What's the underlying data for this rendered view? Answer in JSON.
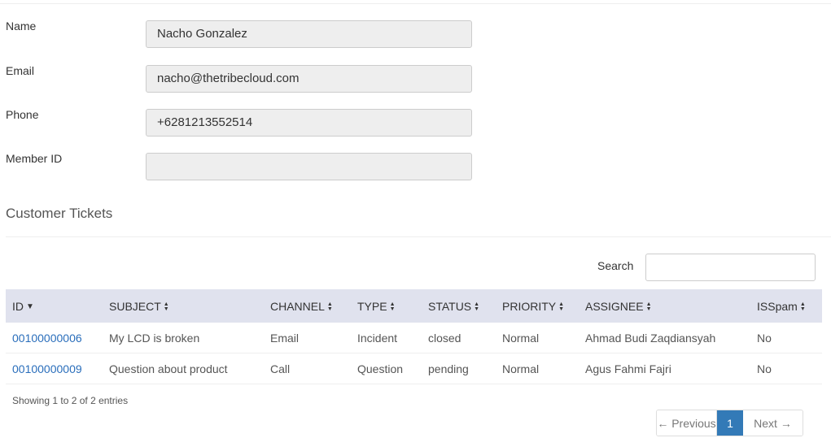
{
  "form": {
    "fields": [
      {
        "label": "Name",
        "value": "Nacho Gonzalez"
      },
      {
        "label": "Email",
        "value": "nacho@thetribecloud.com"
      },
      {
        "label": "Phone",
        "value": "+6281213552514"
      },
      {
        "label": "Member ID",
        "value": ""
      }
    ]
  },
  "tickets_section": {
    "title": "Customer Tickets",
    "search_label": "Search",
    "search_value": ""
  },
  "table": {
    "columns": [
      "ID",
      "SUBJECT",
      "CHANNEL",
      "TYPE",
      "STATUS",
      "PRIORITY",
      "ASSIGNEE",
      "ISSpam"
    ],
    "sorted_column": "ID",
    "sort_direction": "descending",
    "rows": [
      {
        "id": "00100000006",
        "subject": "My LCD is broken",
        "channel": "Email",
        "type": "Incident",
        "status": "closed",
        "priority": "Normal",
        "assignee": "Ahmad Budi Zaqdiansyah",
        "isspam": "No"
      },
      {
        "id": "00100000009",
        "subject": "Question about product",
        "channel": "Call",
        "type": "Question",
        "status": "pending",
        "priority": "Normal",
        "assignee": "Agus Fahmi Fajri",
        "isspam": "No"
      }
    ],
    "info": "Showing 1 to 2 of 2 entries"
  },
  "pagination": {
    "previous_label": "← Previous",
    "current_page": "1",
    "next_label": "Next →"
  },
  "colors": {
    "header_bg": "#e0e2ee",
    "link": "#2a6ebb",
    "active_page": "#337ab7",
    "field_bg": "#eeeeee"
  },
  "icons": {
    "sort_desc": "caret-down-icon",
    "sort_both": "sort-both-icon"
  }
}
